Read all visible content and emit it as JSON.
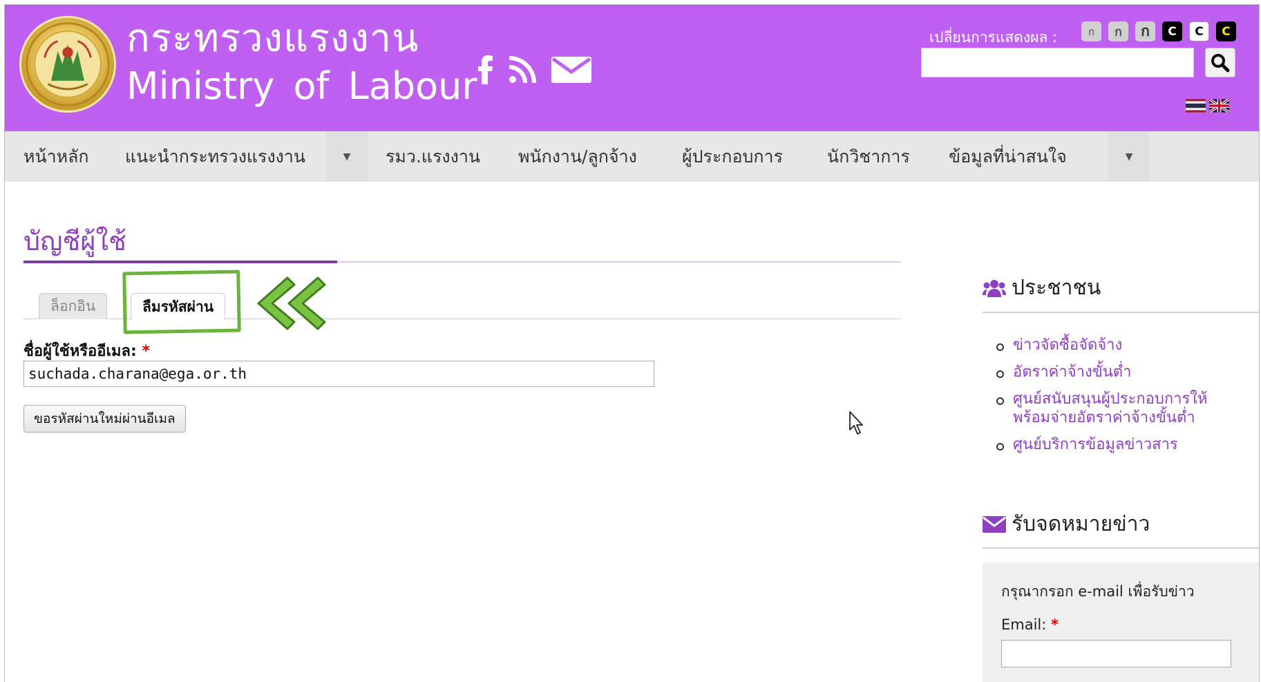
{
  "header": {
    "title_th": "กระทรวงแรงงาน",
    "title_en": "Ministry  of  Labour",
    "display_label": "เปลี่ยนการแสดงผล :",
    "display_buttons": [
      "ก",
      "ก",
      "ก",
      "C",
      "C",
      "C"
    ],
    "search_placeholder": "",
    "icons": [
      "facebook-icon",
      "rss-icon",
      "mail-icon",
      "search-icon",
      "thai-flag-icon",
      "uk-flag-icon"
    ]
  },
  "nav": {
    "items": [
      "หน้าหลัก",
      "แนะนำกระทรวงแรงงาน",
      "รมว.แรงงาน",
      "พนักงาน/ลูกจ้าง",
      "ผู้ประกอบการ",
      "นักวิชาการ",
      "ข้อมูลที่น่าสนใจ"
    ],
    "arrow": "▼"
  },
  "main": {
    "page_title": "บัญชีผู้ใช้",
    "tabs": [
      {
        "label": "ล็อกอิน",
        "active": false
      },
      {
        "label": "ลืมรหัสผ่าน",
        "active": true
      }
    ],
    "field_label": "ชื่อผู้ใช้หรืออีเมล:",
    "required_mark": "*",
    "field_value": "suchada.charana@ega.or.th",
    "submit_label": "ขอรหัสผ่านใหม่ผ่านอีเมล"
  },
  "sidebar": {
    "people_heading": "ประชาชน",
    "links": [
      {
        "line1": "ข่าวจัดซื้อจัดจ้าง",
        "line2": ""
      },
      {
        "line1": "อัตราค่าจ้างขั้นต่ำ",
        "line2": ""
      },
      {
        "line1": "ศูนย์สนับสนุนผู้ประกอบการให้",
        "line2": "พร้อมจ่ายอัตราค่าจ้างขั้นต่ำ"
      },
      {
        "line1": "ศูนย์บริการข้อมูลข่าวสาร",
        "line2": ""
      }
    ],
    "newsletter_heading": "รับจดหมายข่าว",
    "newsletter_text": "กรุณากรอก e-mail เพื่อรับข่าว",
    "email_label": "Email:",
    "required_mark": "*"
  },
  "colors": {
    "header_bg": "#c060f2",
    "nav_bg": "#e7e7e7",
    "accent_purple": "#8e3fc2",
    "highlight_green": "#6bb33b"
  }
}
